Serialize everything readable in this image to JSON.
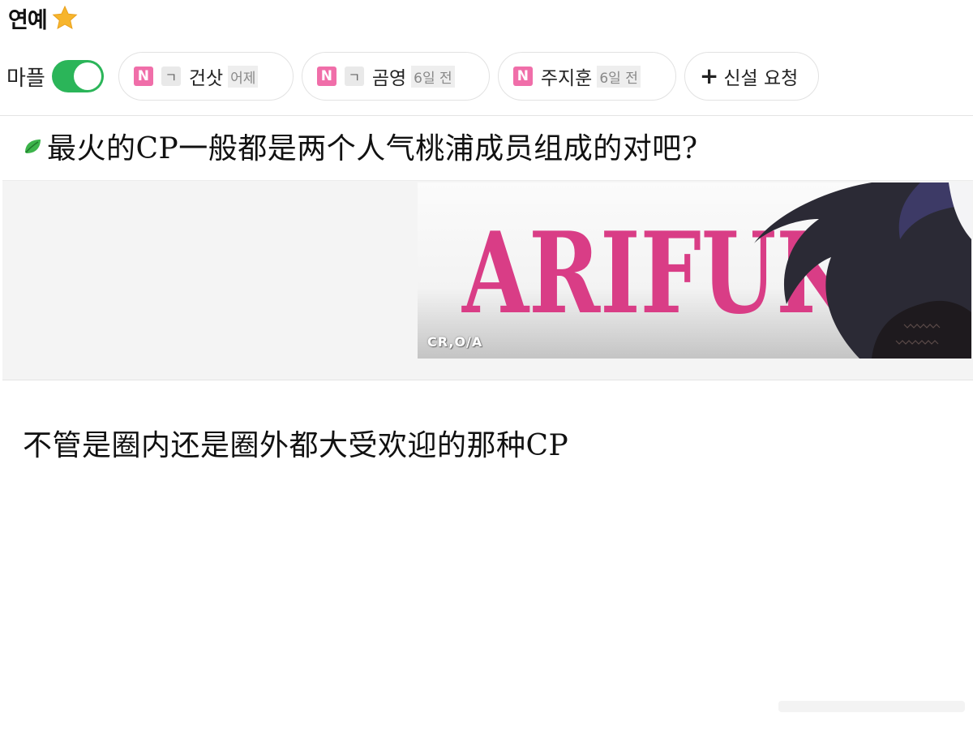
{
  "header": {
    "title": "연예",
    "icon": "star-icon",
    "star_color": "#f7b52c"
  },
  "chips": {
    "mapl_label": "마플",
    "toggle_on": true,
    "toggle_color": "#2bb559",
    "items": [
      {
        "badge": "N",
        "gbadge": "ㄱ",
        "name": "건삿",
        "time": "어제"
      },
      {
        "badge": "N",
        "gbadge": "ㄱ",
        "name": "곰영",
        "time": "6일 전"
      },
      {
        "badge": "N",
        "name": "주지훈",
        "time": "6일 전"
      }
    ],
    "request": {
      "icon": "plus-icon",
      "label": "신설 요청"
    },
    "badge_color": "#f06ea9"
  },
  "question": {
    "icon": "leaf-icon",
    "text": "最火的CP一般都是两个人气桃浦成员组成的对吧?"
  },
  "banner": {
    "title": "ARIFUKE",
    "watermark": "CR,O/A",
    "title_color": "#d93d86"
  },
  "body": {
    "text": "不管是圈内还是圈外都大受欢迎的那种CP"
  }
}
